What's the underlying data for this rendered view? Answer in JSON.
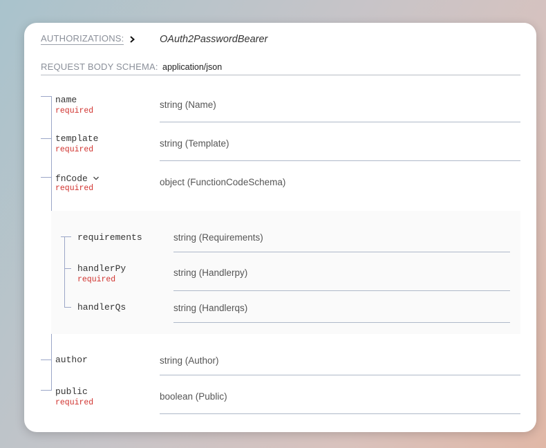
{
  "auth": {
    "label": "AUTHORIZATIONS:",
    "value": "OAuth2PasswordBearer"
  },
  "schema": {
    "label": "REQUEST BODY SCHEMA:",
    "value": "application/json"
  },
  "required_label": "required",
  "fields": {
    "name": {
      "name": "name",
      "type": "string (Name)"
    },
    "template": {
      "name": "template",
      "type": "string (Template)"
    },
    "fnCode": {
      "name": "fnCode",
      "type": "object (FunctionCodeSchema)"
    },
    "requirements": {
      "name": "requirements",
      "type": "string (Requirements)"
    },
    "handlerPy": {
      "name": "handlerPy",
      "type": "string (Handlerpy)"
    },
    "handlerQs": {
      "name": "handlerQs",
      "type": "string (Handlerqs)"
    },
    "author": {
      "name": "author",
      "type": "string (Author)"
    },
    "public": {
      "name": "public",
      "type": "boolean (Public)"
    }
  },
  "icons": {
    "authorizations_expand": "chevron-right-icon",
    "fncode_expand": "chevron-down-icon"
  },
  "colors": {
    "required": "#d0312d",
    "tree_line": "#9ba6c7"
  }
}
